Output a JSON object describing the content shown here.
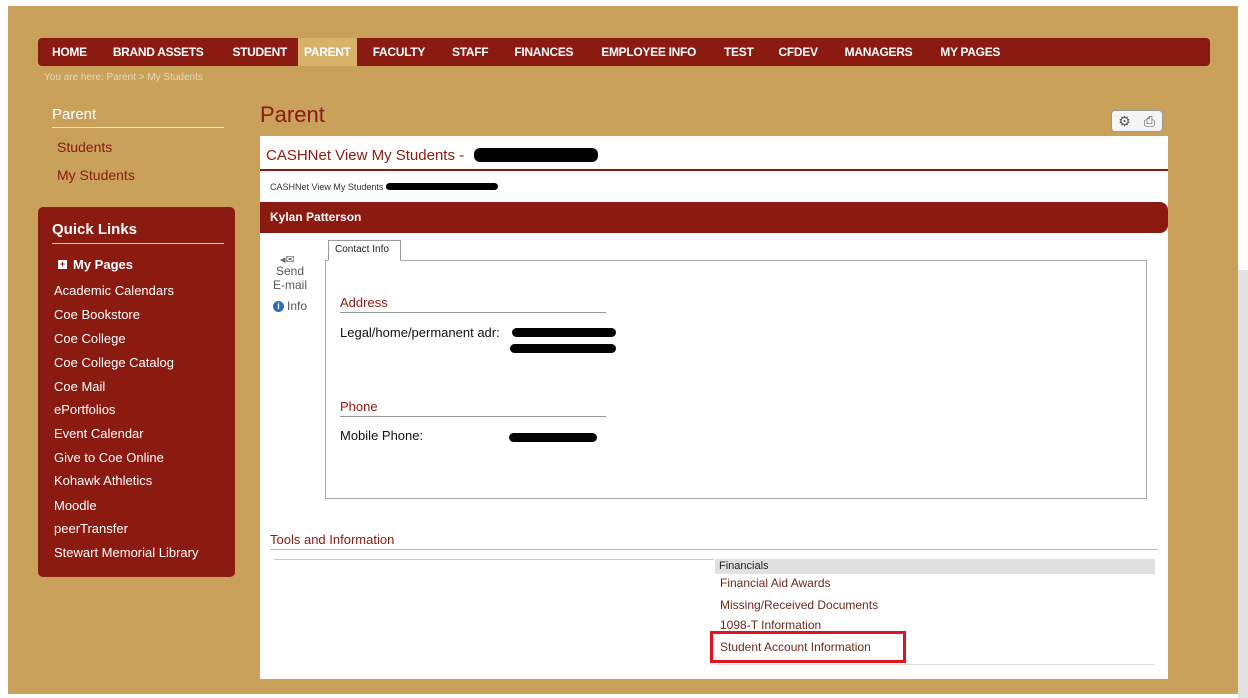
{
  "nav": {
    "items": [
      "HOME",
      "BRAND ASSETS",
      "STUDENT",
      "PARENT",
      "FACULTY",
      "STAFF",
      "FINANCES",
      "EMPLOYEE INFO",
      "TEST",
      "CFDEV",
      "MANAGERS",
      "MY PAGES"
    ],
    "active": "PARENT"
  },
  "breadcrumb": "You are here:  Parent > My Students",
  "sidebar": {
    "heading": "Parent",
    "links": [
      "Students",
      "My Students"
    ]
  },
  "quick_links": {
    "title": "Quick Links",
    "my_pages": "My Pages",
    "items": [
      "Academic Calendars",
      "Coe Bookstore",
      "Coe College",
      "Coe College Catalog",
      "Coe Mail",
      "ePortfolios",
      "Event Calendar",
      "Give to Coe Online",
      "Kohawk Athletics",
      "Moodle",
      "peerTransfer",
      "Stewart Memorial Library"
    ]
  },
  "main": {
    "title": "Parent",
    "panel_title": "CASHNet View My Students -",
    "crumb": "CASHNet View My Students >",
    "student_name": "Kylan Patterson",
    "send_label": "Send E-mail",
    "info_label": "Info",
    "tab_label": "Contact Info",
    "address_heading": "Address",
    "address_label": "Legal/home/permanent adr:",
    "phone_heading": "Phone",
    "phone_label": "Mobile Phone:",
    "tools_heading": "Tools and Information",
    "financials_heading": "Financials",
    "financial_links": [
      "Financial Aid Awards",
      "Missing/Received Documents",
      "1098-T Information",
      "Student Account Information"
    ]
  },
  "icons": {
    "settings": "gear-icon",
    "print": "printer-icon",
    "email": "envelope-icon",
    "info": "info-icon"
  },
  "colors": {
    "brand": "#8b1a10",
    "background": "#c9a15a",
    "highlight": "#e0141f"
  }
}
